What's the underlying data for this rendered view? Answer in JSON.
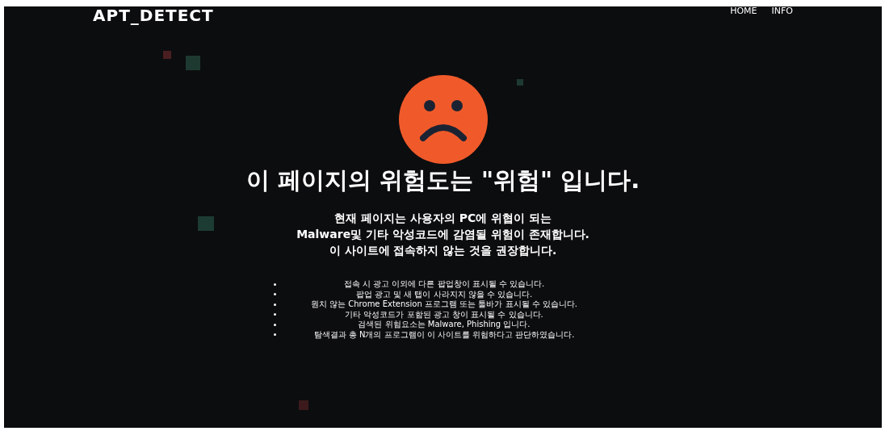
{
  "header": {
    "logo": "APT_DETECT",
    "nav": [
      "HOME",
      "INFO"
    ]
  },
  "verdict": {
    "title": "이 페이지의 위험도는 \"위험\" 입니다.",
    "dangerous": true
  },
  "description": [
    "현재 페이지는 사용자의 PC에 위협이 되는",
    "Malware및 기타 악성코드에 감염될 위험이 존재합니다.",
    "이 사이트에 접속하지 않는 것을 권장합니다."
  ],
  "warnings": [
    "접속 시 광고 이외에 다른 팝업창이 표시될 수 있습니다.",
    "팝업 광고 및 새 탭이 사라지지 않을 수 있습니다.",
    "원치 않는 Chrome Extension 프로그램 또는 툴바가 표시될 수 있습니다.",
    "기타 악성코드가 포함된 광고 창이 표시될 수 있습니다.",
    "검색된 위험요소는 Malware, Phishing 입니다.",
    "탐색결과 총 N개의 프로그램이 이 사이트를 위험하다고 판단하였습니다."
  ]
}
